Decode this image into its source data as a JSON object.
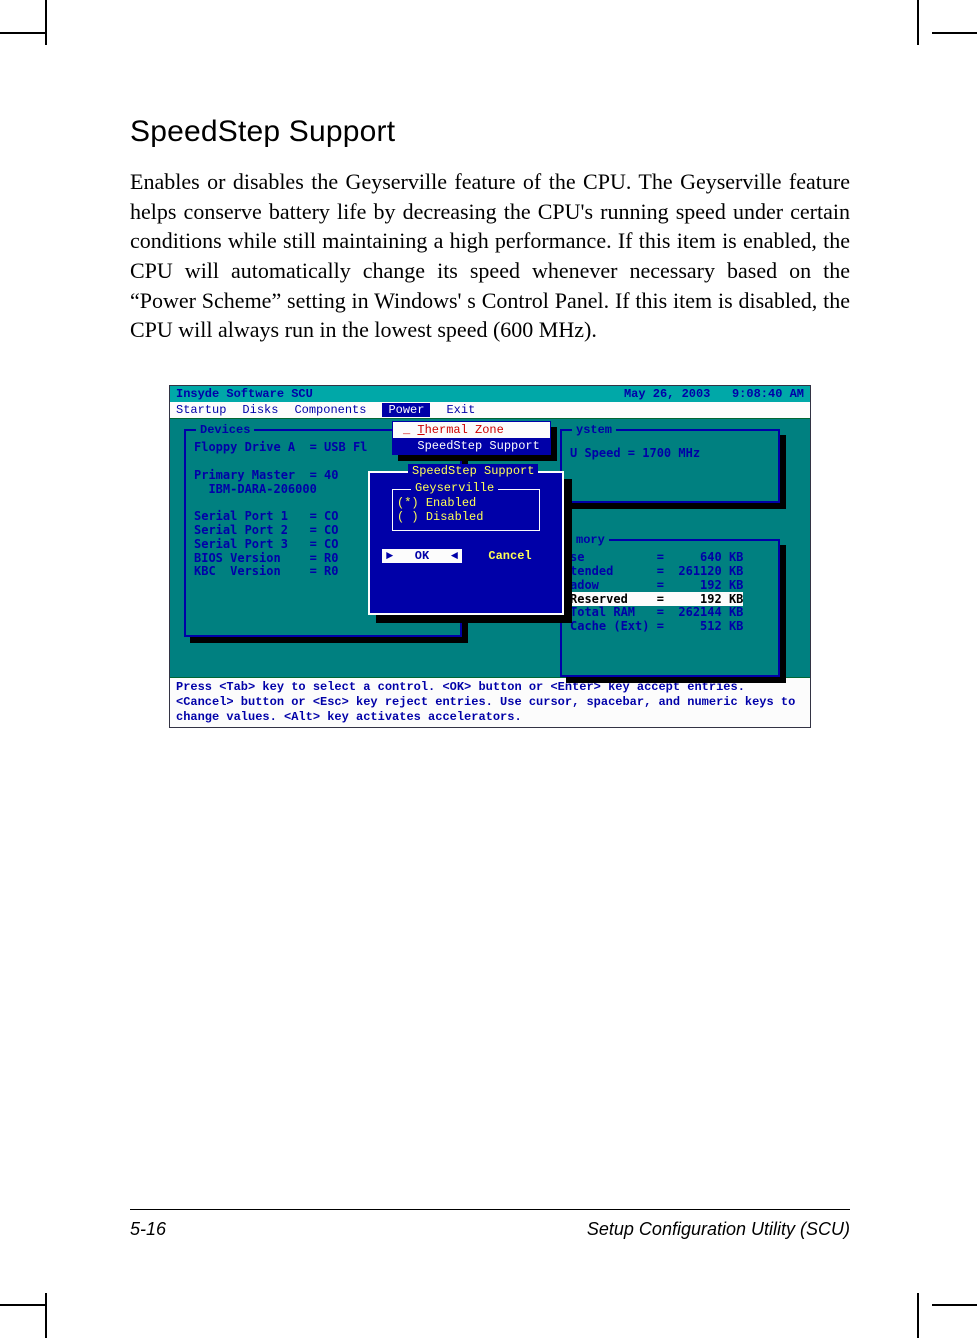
{
  "heading": "SpeedStep Support",
  "paragraph": "Enables or disables the Geyserville feature of the CPU. The Geyserville feature helps conserve battery life by decreasing the CPU's running speed under certain conditions while still maintaining a high performance. If this item is enabled, the CPU will automatically change its speed whenever necessary based on the “Power Scheme” setting in Windows' s Control Panel. If this item is disabled, the CPU will always run in the lowest speed (600 MHz).",
  "bios": {
    "title_left": "Insyde Software SCU",
    "title_date": "May 26, 2003",
    "title_time": "9:08:40 AM",
    "menu": [
      "Startup",
      "Disks",
      "Components",
      "Power",
      "Exit"
    ],
    "menu_selected": "Power",
    "dropdown": {
      "items": [
        {
          "label": "_ Thermal Zone",
          "hotkey": "T"
        },
        {
          "label": "  SpeedStep Support",
          "selected": true
        }
      ]
    },
    "devices_title": "Devices",
    "devices_lines": [
      "Floppy Drive A  = USB Fl",
      "",
      "Primary Master  = 40",
      "  IBM-DARA-206000",
      "",
      "Serial Port 1   = CO",
      "Serial Port 2   = CO",
      "Serial Port 3   = CO",
      "BIOS Version    = R0",
      "KBC  Version    = R0"
    ],
    "system_title": "ystem",
    "system_line": "U Speed = 1700 MHz",
    "memory_title": "mory",
    "memory_lines": [
      {
        "label": "se",
        "op": "=",
        "value": "640 KB"
      },
      {
        "label": "tended",
        "op": "=",
        "value": "261120 KB"
      },
      {
        "label": "adow",
        "op": "=",
        "value": "192 KB"
      },
      {
        "label": "Reserved",
        "op": "=",
        "value": "192 KB",
        "reserved": true
      },
      {
        "label": "Total RAM",
        "op": "=",
        "value": "262144 KB"
      },
      {
        "label": "Cache (Ext)",
        "op": "=",
        "value": "512 KB"
      }
    ],
    "dialog": {
      "title": "SpeedStep Support",
      "group": "Geyserville",
      "options": [
        {
          "mark": "(*)",
          "label": "Enabled"
        },
        {
          "mark": "( )",
          "label": "Disabled"
        }
      ],
      "ok": "OK",
      "cancel": "Cancel"
    },
    "help": "Press <Tab> key to select a control. <OK> button or <Enter> key accept entries. <Cancel> button or <Esc> key reject entries. Use cursor, spacebar, and numeric keys to change values. <Alt> key activates accelerators."
  },
  "footer": {
    "page": "5-16",
    "section": "Setup Configuration Utility (SCU)"
  }
}
